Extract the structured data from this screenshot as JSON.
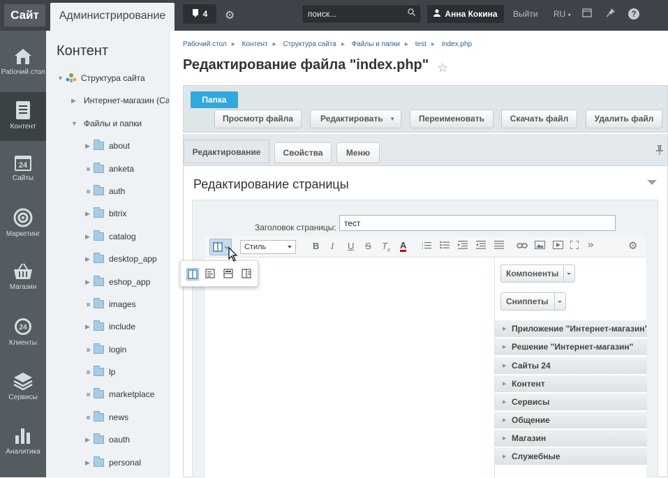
{
  "topbar": {
    "site_button": "Сайт",
    "admin_tab": "Администрирование",
    "notifications_count": "4",
    "search_placeholder": "поиск...",
    "user_name": "Анна Кокина",
    "logout": "Выйти",
    "lang": "RU",
    "icons": [
      "settings-icon",
      "search-icon",
      "user-icon",
      "calendar-icon",
      "pin-icon",
      "help-icon"
    ]
  },
  "leftnav": [
    {
      "label": "Рабочий стол",
      "icon": "home-icon"
    },
    {
      "label": "Контент",
      "icon": "document-icon",
      "active": true
    },
    {
      "label": "Сайты",
      "icon": "calendar-24-icon"
    },
    {
      "label": "Маркетинг",
      "icon": "target-icon"
    },
    {
      "label": "Магазин",
      "icon": "basket-icon"
    },
    {
      "label": "Клиенты",
      "icon": "clients-24-icon"
    },
    {
      "label": "Сервисы",
      "icon": "layers-icon"
    },
    {
      "label": "Аналитика",
      "icon": "bar-chart-icon"
    }
  ],
  "tree": {
    "title": "Контент",
    "root": "Структура сайта",
    "shop": "Интернет-магазин (Сайт по умолчанию)",
    "files": "Файлы и папки",
    "folders": [
      "about",
      "anketa",
      "auth",
      "bitrix",
      "catalog",
      "desktop_app",
      "eshop_app",
      "images",
      "include",
      "login",
      "lp",
      "marketplace",
      "news",
      "oauth",
      "personal"
    ]
  },
  "breadcrumbs": [
    "Рабочий стол",
    "Контент",
    "Структура сайта",
    "Файлы и папки",
    "test",
    "index.php"
  ],
  "page_title": "Редактирование файла \"index.php\"",
  "toolbar": {
    "folder_label": "Папка",
    "buttons": [
      "Просмотр файла",
      "Редактировать",
      "Переименовать",
      "Скачать файл",
      "Удалить файл"
    ]
  },
  "tabs": [
    "Редактирование",
    "Свойства",
    "Меню"
  ],
  "section_title": "Редактирование страницы",
  "form": {
    "title_label": "Заголовок страницы:",
    "title_value": "тест",
    "style_select": "Стиль"
  },
  "side_panel": {
    "components_button": "Компоненты",
    "snippets_button": "Сниппеты",
    "sections": [
      "Приложение \"Интернет-магазин\"",
      "Решение \"Интернет-магазин\"",
      "Сайты 24",
      "Контент",
      "Сервисы",
      "Общение",
      "Магазин",
      "Служебные"
    ]
  },
  "colors": {
    "topbar": "#3d4348",
    "leftnav": "#535c60",
    "accent": "#2fa9e0",
    "link": "#2c6195"
  }
}
